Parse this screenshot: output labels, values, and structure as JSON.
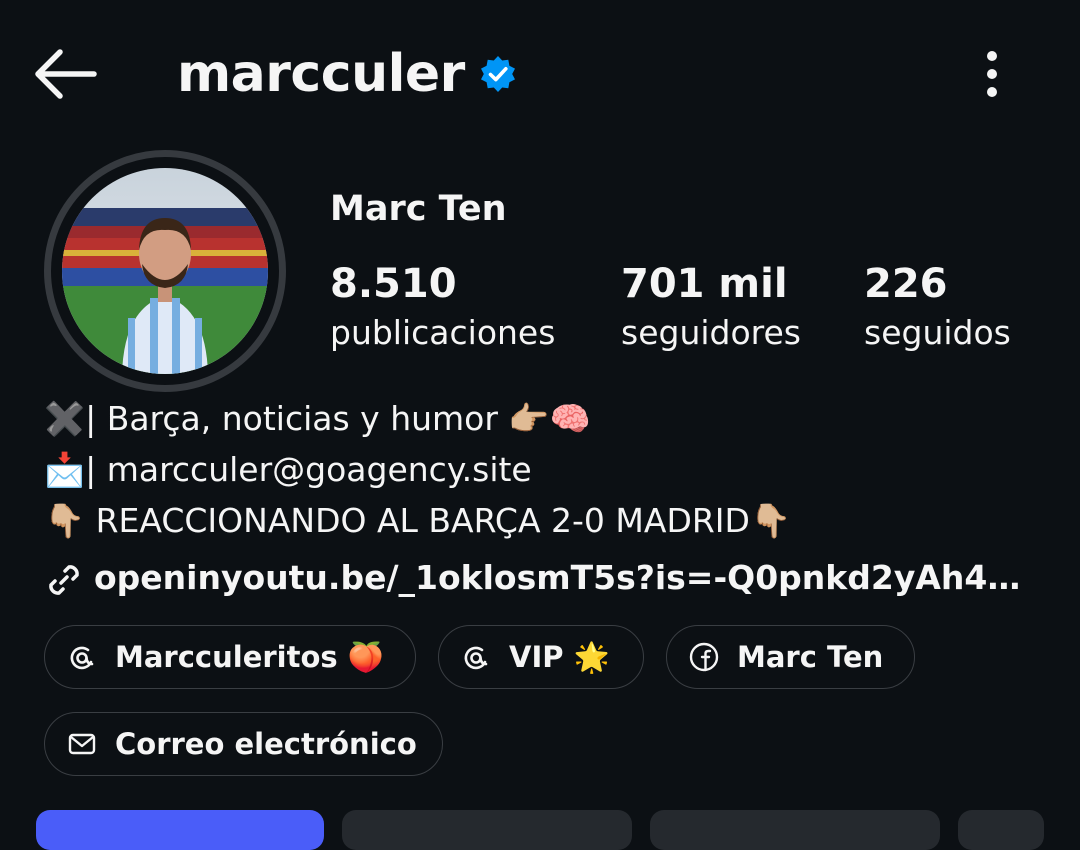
{
  "header": {
    "username": "marcculer"
  },
  "profile": {
    "display_name": "Marc Ten",
    "stats": [
      {
        "value": "8.510",
        "label": "publicaciones"
      },
      {
        "value": "701 mil",
        "label": "seguidores"
      },
      {
        "value": "226",
        "label": "seguidos"
      }
    ]
  },
  "bio": {
    "line1": "✖️| Barça, noticias y humor 👉🏼🧠",
    "line2": "📩| marcculer@goagency.site",
    "line3": "👇🏼 REACCIONANDO AL BARÇA 2-0 MADRID👇🏼"
  },
  "link": {
    "text": "openinyoutu.be/_1oklosmT5s?is=-Q0pnkd2yAh4…"
  },
  "chips": [
    {
      "label": "Marcculeritos 🍑",
      "icon": "threads-icon"
    },
    {
      "label": "VIP 🌟",
      "icon": "threads-icon"
    },
    {
      "label": "Marc Ten",
      "icon": "facebook-icon"
    },
    {
      "label": "Correo electrónico",
      "icon": "mail-icon"
    }
  ],
  "colors": {
    "background": "#0c1014",
    "verified": "#0095f6",
    "primary_button": "#4a5df9",
    "secondary_button": "#25292e",
    "chip_border": "#3a3e43"
  }
}
